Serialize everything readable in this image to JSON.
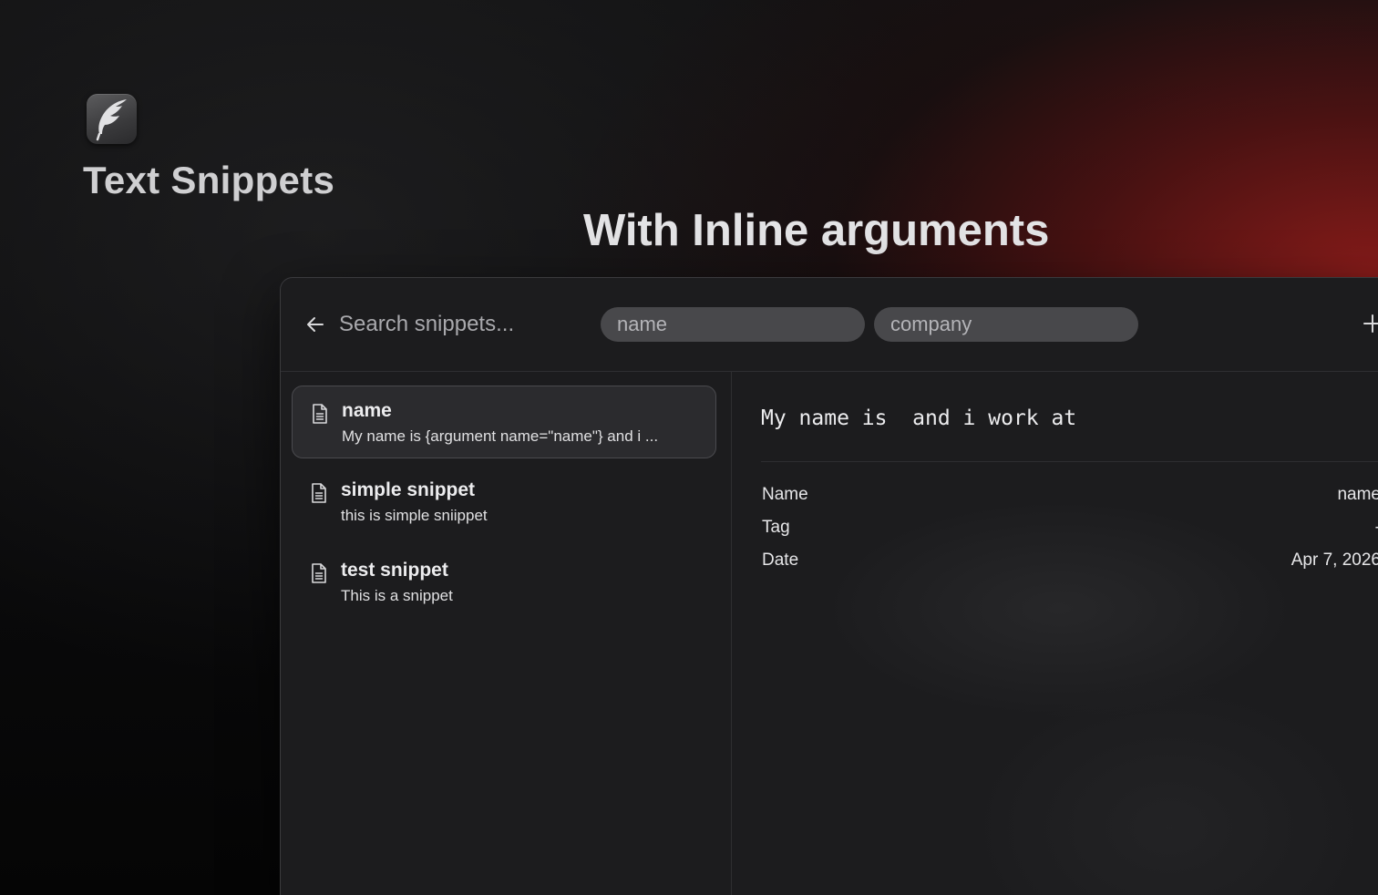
{
  "brand": {
    "title": "Text Snippets",
    "icon": "feather-icon"
  },
  "hero": {
    "heading": "With Inline arguments"
  },
  "search": {
    "placeholder": "Search snippets...",
    "back_icon": "arrow-left-icon",
    "add_icon": "plus-icon"
  },
  "arguments": [
    {
      "placeholder": "name"
    },
    {
      "placeholder": "company"
    }
  ],
  "snippets": [
    {
      "title": "name",
      "preview": "My name is {argument name=\"name\"} and i ...",
      "icon": "document-icon",
      "selected": true
    },
    {
      "title": "simple snippet",
      "preview": "this is simple sniippet",
      "icon": "document-icon",
      "selected": false
    },
    {
      "title": "test snippet",
      "preview": "This is a snippet",
      "icon": "document-icon",
      "selected": false
    }
  ],
  "detail": {
    "preview": "My name is  and i work at",
    "metadata": [
      {
        "label": "Name",
        "value": "name"
      },
      {
        "label": "Tag",
        "value": "-"
      },
      {
        "label": "Date",
        "value": "Apr 7, 2026"
      }
    ]
  }
}
